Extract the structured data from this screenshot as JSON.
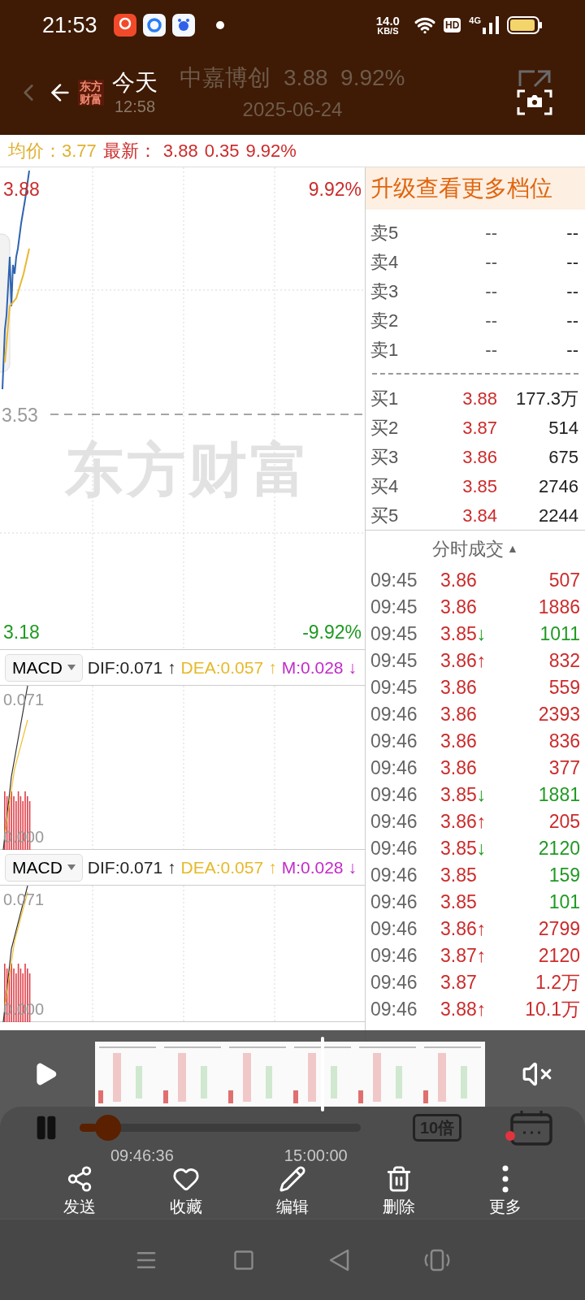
{
  "status_bar": {
    "time": "21:53",
    "net_speed": "14.0",
    "net_unit": "KB/S",
    "hd_badge": "HD",
    "network_type": "4G"
  },
  "header": {
    "logo": [
      "东方",
      "财富"
    ],
    "day": "今天",
    "clock": "12:58",
    "title": "中嘉博创  3.88  9.92%",
    "date": "2025-06-24"
  },
  "quote_bar": {
    "avg_label": "均价：",
    "avg_value": "3.77",
    "latest_label": "最新：",
    "latest_value": "3.88",
    "change": "0.35",
    "change_pct": "9.92%"
  },
  "chart": {
    "high_price": "3.88",
    "high_pct": "9.92%",
    "base_price": "3.53",
    "low_price": "3.18",
    "low_pct": "-9.92%",
    "watermark": "东方财富"
  },
  "indicators": [
    {
      "name": "MACD",
      "dif": "DIF:0.071",
      "dif_arrow": "↑",
      "dea": "DEA:0.057",
      "dea_arrow": "↑",
      "m": "M:0.028",
      "m_arrow": "↓",
      "top_label": "0.071",
      "bottom_label": "0.000"
    },
    {
      "name": "MACD",
      "dif": "DIF:0.071",
      "dif_arrow": "↑",
      "dea": "DEA:0.057",
      "dea_arrow": "↑",
      "m": "M:0.028",
      "m_arrow": "↓",
      "top_label": "0.071",
      "bottom_label": "0.000"
    }
  ],
  "order_book": {
    "banner": "升级查看更多档位",
    "asks": [
      {
        "label": "卖5",
        "price": "--",
        "volume": "--"
      },
      {
        "label": "卖4",
        "price": "--",
        "volume": "--"
      },
      {
        "label": "卖3",
        "price": "--",
        "volume": "--"
      },
      {
        "label": "卖2",
        "price": "--",
        "volume": "--"
      },
      {
        "label": "卖1",
        "price": "--",
        "volume": "--"
      }
    ],
    "bids": [
      {
        "label": "买1",
        "price": "3.88",
        "volume": "177.3万"
      },
      {
        "label": "买2",
        "price": "3.87",
        "volume": "514"
      },
      {
        "label": "买3",
        "price": "3.86",
        "volume": "675"
      },
      {
        "label": "买4",
        "price": "3.85",
        "volume": "2746"
      },
      {
        "label": "买5",
        "price": "3.84",
        "volume": "2244"
      }
    ]
  },
  "trades": {
    "title": "分时成交",
    "sort_mark": "▲",
    "rows": [
      {
        "time": "09:45",
        "price": "3.86",
        "volume": "507",
        "kind": "buy"
      },
      {
        "time": "09:45",
        "price": "3.86",
        "volume": "1886",
        "kind": "buy"
      },
      {
        "time": "09:45",
        "price": "3.85",
        "arrow": "↓",
        "volume": "1011",
        "kind": "sell"
      },
      {
        "time": "09:45",
        "price": "3.86",
        "arrow": "↑",
        "volume": "832",
        "kind": "buy"
      },
      {
        "time": "09:45",
        "price": "3.86",
        "volume": "559",
        "kind": "buy"
      },
      {
        "time": "09:46",
        "price": "3.86",
        "volume": "2393",
        "kind": "buy"
      },
      {
        "time": "09:46",
        "price": "3.86",
        "volume": "836",
        "kind": "buy"
      },
      {
        "time": "09:46",
        "price": "3.86",
        "volume": "377",
        "kind": "buy"
      },
      {
        "time": "09:46",
        "price": "3.85",
        "arrow": "↓",
        "volume": "1881",
        "kind": "sell"
      },
      {
        "time": "09:46",
        "price": "3.86",
        "arrow": "↑",
        "volume": "205",
        "kind": "buy"
      },
      {
        "time": "09:46",
        "price": "3.85",
        "arrow": "↓",
        "volume": "2120",
        "kind": "sell"
      },
      {
        "time": "09:46",
        "price": "3.85",
        "volume": "159",
        "kind": "sell"
      },
      {
        "time": "09:46",
        "price": "3.85",
        "volume": "101",
        "kind": "sell"
      },
      {
        "time": "09:46",
        "price": "3.86",
        "arrow": "↑",
        "volume": "2799",
        "kind": "buy"
      },
      {
        "time": "09:46",
        "price": "3.87",
        "arrow": "↑",
        "volume": "2120",
        "kind": "buy"
      },
      {
        "time": "09:46",
        "price": "3.87",
        "volume": "1.2万",
        "kind": "buy"
      },
      {
        "time": "09:46",
        "price": "3.88",
        "arrow": "↑",
        "volume": "10.1万",
        "kind": "buy"
      }
    ]
  },
  "player": {
    "muted": true,
    "progress": {
      "level": 0.06
    },
    "elapsed": "09:46:36",
    "total": "15:00:00",
    "speed": "10倍",
    "calendar_badge": true,
    "actions": [
      {
        "kind": "share",
        "label": "发送"
      },
      {
        "kind": "favorite",
        "label": "收藏"
      },
      {
        "kind": "edit",
        "label": "编辑"
      },
      {
        "kind": "delete",
        "label": "删除"
      },
      {
        "kind": "more",
        "label": "更多"
      }
    ]
  },
  "nav_bar": {
    "buttons": [
      {
        "kind": "recents"
      },
      {
        "kind": "home"
      },
      {
        "kind": "back"
      },
      {
        "kind": "rotate"
      }
    ]
  }
}
